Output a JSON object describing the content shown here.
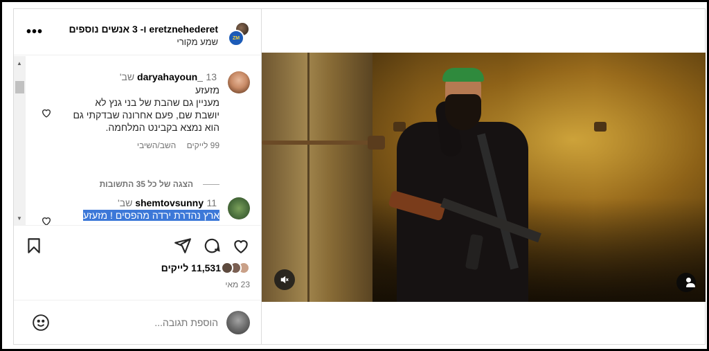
{
  "header": {
    "title": "eretznehederet ו- 3 אנשים נוספים",
    "subtitle": "שמע מקורי",
    "avatar_badge": "ZM",
    "more_label": "•••"
  },
  "comments": [
    {
      "user": "daryahayoun_",
      "time": "13 שב'",
      "lines": [
        "מזעזע",
        "מעניין גם שהבת של בני גנץ לא",
        "יושבת שם, פעם אחרונה שבדקתי גם",
        "הוא נמצא בקבינט המלחמה."
      ],
      "likes": "99 לייקים",
      "reply": "השב/השיבי"
    },
    {
      "user": "shemtovsunny",
      "time": "11 שב'",
      "text_selected": "ארץ נהדרת ירדה מהפסים ! מזעזע"
    }
  ],
  "replies_link": "הצגה של כל 35 התשובות",
  "likes_count": "11,531 לייקים",
  "date": "23 מאי",
  "add_comment_placeholder": "הוספת תגובה...",
  "icons": {
    "heart": "heart-icon",
    "comment": "comment-icon",
    "share": "share-icon",
    "save": "bookmark-icon",
    "emoji": "emoji-icon",
    "mute": "speaker-muted-icon",
    "tag": "person-tag-icon"
  },
  "colors": {
    "selection": "#3c78d8",
    "muted_text": "#737373",
    "border": "#dbdbdb"
  }
}
